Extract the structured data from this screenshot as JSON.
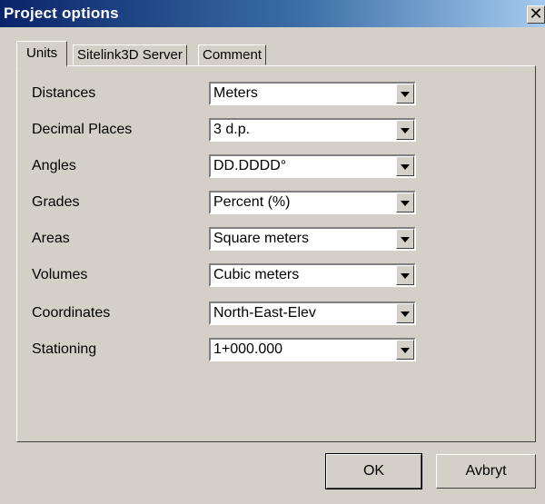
{
  "window": {
    "title": "Project options",
    "close_glyph": "✕"
  },
  "tabs": [
    {
      "label": "Units",
      "active": true
    },
    {
      "label": "Sitelink3D Server",
      "active": false
    },
    {
      "label": "Comment",
      "active": false
    }
  ],
  "units": [
    {
      "label": "Distances",
      "value": "Meters"
    },
    {
      "label": "Decimal Places",
      "value": "3 d.p."
    },
    {
      "label": "Angles",
      "value": "DD.DDDD°"
    },
    {
      "label": "Grades",
      "value": "Percent (%)"
    },
    {
      "label": "Areas",
      "value": "Square meters"
    },
    {
      "label": "Volumes",
      "value": "Cubic meters"
    },
    {
      "label": "Coordinates",
      "value": "North-East-Elev"
    },
    {
      "label": "Stationing",
      "value": "1+000.000"
    }
  ],
  "buttons": {
    "ok": "OK",
    "cancel": "Avbryt"
  },
  "colors": {
    "titlebar_start": "#0a246a",
    "titlebar_end": "#a6caf0",
    "face": "#d4d0c8"
  }
}
